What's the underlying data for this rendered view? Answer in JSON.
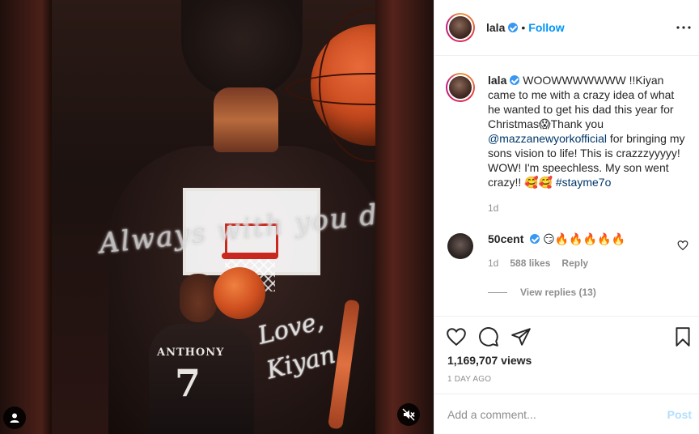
{
  "media": {
    "jersey_script": "Always with you dad",
    "small_jersey_name": "ANTHONY",
    "small_jersey_number": "7",
    "love_script_line1": "Love,",
    "love_script_line2": "Kiyan",
    "user_tag_icon": "user-icon",
    "mute_icon": "speaker-muted-icon"
  },
  "header": {
    "username": "lala",
    "separator": "•",
    "follow_label": "Follow",
    "more_icon": "more-horizontal-icon"
  },
  "caption": {
    "username": "lala",
    "text_part1": "WOOWWWWWWW !!Kiyan came to me with a crazy idea of what he wanted to get his dad this year for Christmas😱Thank you",
    "mention": "@mazzanewyorkofficial",
    "text_part2": "for bringing my sons vision to life! This is crazzzyyyyy! WOW! I'm speechless. My son went crazy!! 🥰🥰",
    "hashtag": "#stayme7o",
    "time": "1d"
  },
  "comment": {
    "username": "50cent",
    "text": "😏🔥🔥🔥🔥🔥",
    "time": "1d",
    "likes": "588 likes",
    "reply_label": "Reply",
    "view_replies": "View replies (13)"
  },
  "actions": {
    "like_icon": "heart-icon",
    "comment_icon": "comment-icon",
    "share_icon": "share-icon",
    "save_icon": "bookmark-icon"
  },
  "stats": {
    "views": "1,169,707 views",
    "posted": "1 DAY AGO"
  },
  "add_comment": {
    "placeholder": "Add a comment...",
    "post_label": "Post"
  },
  "colors": {
    "accent": "#0095f6",
    "verified": "#3897f0",
    "muted_text": "#8e8e8e",
    "post_disabled": "#b2dffc"
  }
}
